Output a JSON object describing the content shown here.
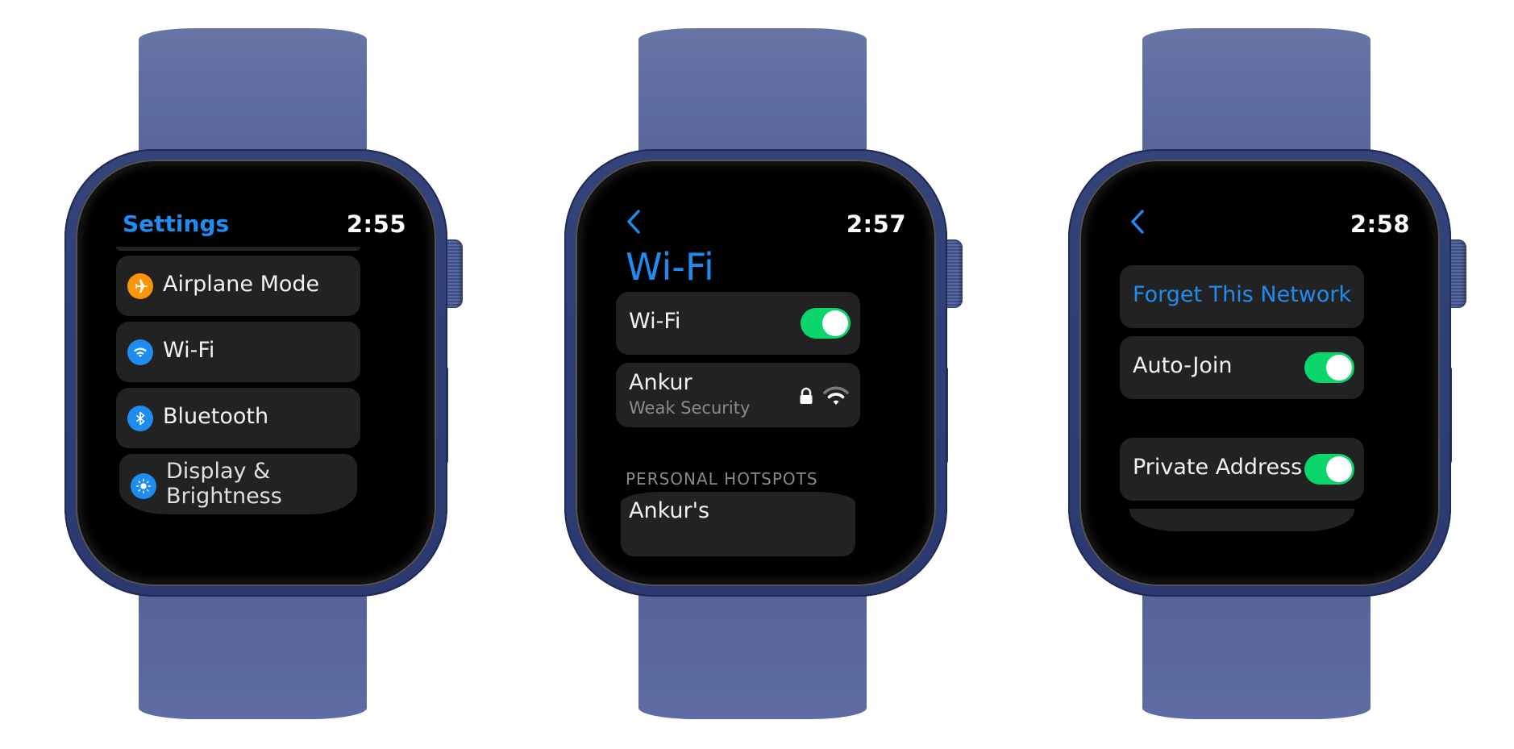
{
  "colors": {
    "accent": "#1f8cf0",
    "toggle_on": "#0ad66c",
    "row_bg": "#222223",
    "band": "#5b6aa0",
    "airplane_icon_bg": "#fb9406",
    "wifi_icon_bg": "#1f8cf0",
    "bluetooth_icon_bg": "#1f8cf0",
    "display_icon_bg": "#1f8cf0"
  },
  "watches": [
    {
      "screen": "settings",
      "header": {
        "title": "Settings",
        "time": "2:55"
      },
      "items": [
        {
          "label": "Airplane Mode",
          "icon": "airplane-icon"
        },
        {
          "label": "Wi-Fi",
          "icon": "wifi-icon"
        },
        {
          "label": "Bluetooth",
          "icon": "bluetooth-icon"
        },
        {
          "label": "Display & Brightness",
          "label_line1": "Display &",
          "label_line2": "Brightness",
          "icon": "brightness-icon"
        }
      ]
    },
    {
      "screen": "wifi",
      "header": {
        "back": "back-chevron-icon",
        "time": "2:57",
        "title": "Wi-Fi"
      },
      "wifi_toggle": {
        "label": "Wi-Fi",
        "on": true
      },
      "networks": [
        {
          "name": "Ankur",
          "subtitle": "Weak Security",
          "locked": true,
          "signal_bars": 2,
          "signal_max": 3
        }
      ],
      "section_header": "PERSONAL HOTSPOTS",
      "hotspots": [
        {
          "name": "Ankur's"
        }
      ]
    },
    {
      "screen": "network-detail",
      "header": {
        "back": "back-chevron-icon",
        "time": "2:58"
      },
      "forget_label": "Forget This Network",
      "auto_join": {
        "label": "Auto-Join",
        "on": true
      },
      "private_address": {
        "label": "Private Address",
        "on": true
      }
    }
  ]
}
